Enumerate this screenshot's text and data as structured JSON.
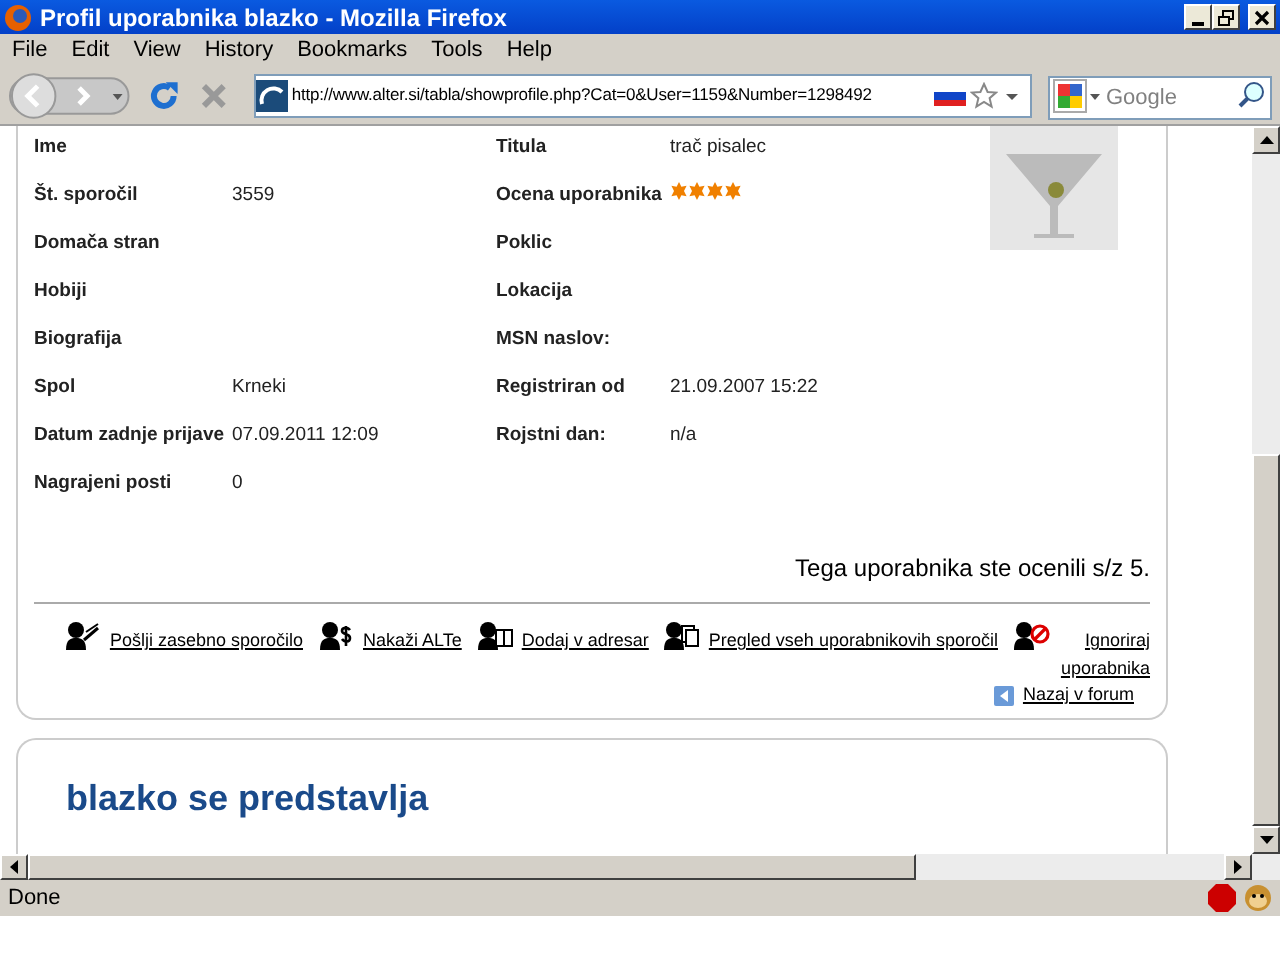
{
  "window": {
    "title": "Profil uporabnika blazko - Mozilla Firefox"
  },
  "menu": [
    "File",
    "Edit",
    "View",
    "History",
    "Bookmarks",
    "Tools",
    "Help"
  ],
  "address_bar": {
    "value": "http://www.alter.si/tabla/showprofile.php?Cat=0&User=1159&Number=1298492"
  },
  "search": {
    "placeholder": "Google"
  },
  "profile": {
    "left": [
      {
        "label": "Ime"
      },
      {
        "label": "Št. sporočil",
        "value": "3559"
      },
      {
        "label": "Domača stran"
      },
      {
        "label": "Hobiji"
      },
      {
        "label": "Biografija"
      },
      {
        "label": "Spol",
        "value": "Krneki"
      },
      {
        "label": "Datum zadnje prijave",
        "value": "07.09.2011 12:09"
      },
      {
        "label": "Nagrajeni posti",
        "value": "0"
      }
    ],
    "right": [
      {
        "label": "Titula",
        "value": "trač pisalec"
      },
      {
        "label": "Ocena uporabnika",
        "stars": 4
      },
      {
        "label": "Poklic"
      },
      {
        "label": "Lokacija"
      },
      {
        "label": "MSN naslov:"
      },
      {
        "label": "Registriran od",
        "value": "21.09.2007 15:22"
      },
      {
        "label": "Rojstni dan:",
        "value": "n/a"
      }
    ]
  },
  "rating_note": "Tega uporabnika ste ocenili s/z 5.",
  "actions": [
    {
      "label": "Pošlji zasebno sporočilo",
      "kind": "message"
    },
    {
      "label": "Nakaži ALTe",
      "kind": "money"
    },
    {
      "label": "Dodaj v adresar",
      "kind": "book"
    },
    {
      "label": "Pregled vseh uporabnikovih sporočil",
      "kind": "posts"
    },
    {
      "label": "Ignoriraj uporabnika",
      "kind": "ignore"
    }
  ],
  "back_link": "Nazaj v forum",
  "intro": {
    "heading": "blazko se predstavlja"
  },
  "status_bar": {
    "text": "Done"
  }
}
